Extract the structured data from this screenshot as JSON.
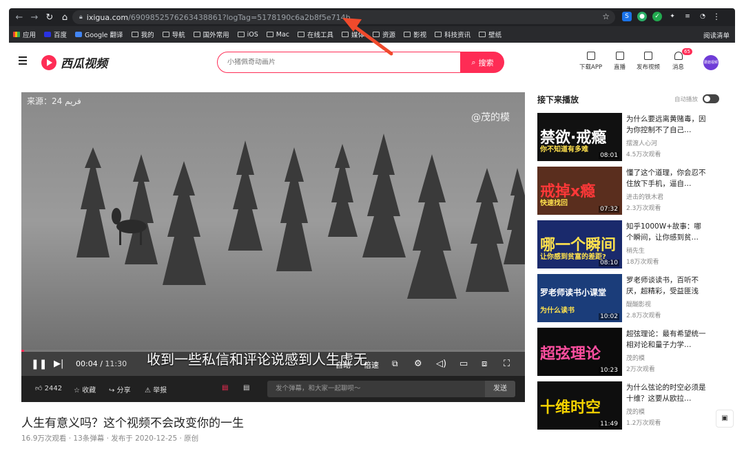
{
  "browser": {
    "url_host": "ixigua.com",
    "url_path": "/6909852576263438861?logTag=5178190c6a2b8f5e714b",
    "bookmarks": [
      "应用",
      "百度",
      "Google 翻译",
      "我的",
      "导航",
      "国外常用",
      "iOS",
      "Mac",
      "在线工具",
      "媒体",
      "资源",
      "影视",
      "科技资讯",
      "壁纸"
    ],
    "reading_list": "阅读清单"
  },
  "header": {
    "logo": "西瓜视频",
    "search_placeholder": "小猪佩奇动画片",
    "search_button": "搜索",
    "actions": [
      {
        "label": "下载APP",
        "icon": "download-icon"
      },
      {
        "label": "直播",
        "icon": "live-icon"
      },
      {
        "label": "发布视频",
        "icon": "upload-icon"
      },
      {
        "label": "消息",
        "icon": "bell-icon",
        "badge": "65"
      }
    ],
    "avatar_text": "蘑菇视频"
  },
  "player": {
    "source_label": "来源：24 فريم",
    "watermark": "@茂的模",
    "subtitle": "收到一些私信和评论说感到人生虚无",
    "current_time": "00:04",
    "total_time": "11:30",
    "progress": 0.006,
    "autoplay_label": "自动",
    "speed_label": "倍速",
    "likes": "2442",
    "collect": "收藏",
    "share": "分享",
    "report": "举报",
    "danmu_placeholder": "发个弹幕，和大家一起聊呗～",
    "danmu_send": "发送"
  },
  "video": {
    "title": "人生有意义吗？这个视频不会改变你的一生",
    "meta": "16.9万次观看 · 13条弹幕 · 发布于 2020-12-25 · 原创"
  },
  "sidebar": {
    "heading": "接下来播放",
    "autoplay_label": "自动播放",
    "items": [
      {
        "title": "为什么要远离黄赌毒，因为你控制不了自己…",
        "author": "摆渡人心河",
        "views": "4.5万次观看",
        "duration": "08:01",
        "thumb_text": "禁欲·戒瘾",
        "thumb_sub": "你不知道有多难",
        "bg": "#111111",
        "fg": "#ffffff"
      },
      {
        "title": "懂了这个道理，你会忍不住放下手机，逼自…",
        "author": "进击的铁木君",
        "views": "2.3万次观看",
        "duration": "07:32",
        "thumb_text": "戒掉x瘾",
        "thumb_sub": "快速找回",
        "bg": "#5a2e1e",
        "fg": "#ff3838"
      },
      {
        "title": "知乎1000W+故事：哪个瞬间，让你感到贫…",
        "author": "稍先生",
        "views": "18万次观看",
        "duration": "08:10",
        "thumb_text": "哪一个瞬间",
        "thumb_sub": "让你感到贫富的差距?",
        "bg": "#1a2a6c",
        "fg": "#ffe14d"
      },
      {
        "title": "罗老师谈读书，百听不厌，超精彩，受益匪浅",
        "author": "醍醐影视",
        "views": "2.8万次观看",
        "duration": "10:02",
        "thumb_text": "罗老师读书小课堂",
        "thumb_sub": "为什么读书",
        "bg": "#1b3d7a",
        "fg": "#ffffff"
      },
      {
        "title": "超弦理论：最有希望统一相对论和量子力学…",
        "author": "茂的模",
        "views": "2万次观看",
        "duration": "10:23",
        "thumb_text": "超弦理论",
        "thumb_sub": "",
        "bg": "#0b0b0b",
        "fg": "#ff4fa0"
      },
      {
        "title": "为什么弦论的时空必须是十维？这要从欧拉…",
        "author": "茂的模",
        "views": "1.2万次观看",
        "duration": "11:49",
        "thumb_text": "十维时空",
        "thumb_sub": "",
        "bg": "#0e0e0e",
        "fg": "#f5d300"
      }
    ]
  },
  "colors": {
    "accent": "#fe2c55",
    "annotation_arrow": "#f04a2c"
  }
}
